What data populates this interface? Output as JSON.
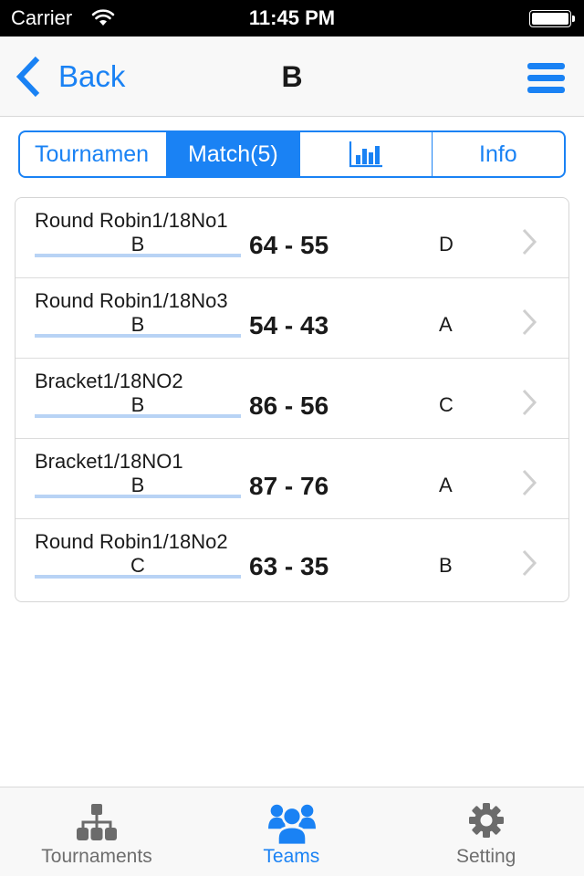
{
  "status_bar": {
    "carrier": "Carrier",
    "time": "11:45 PM",
    "wifi_icon": "wifi-icon",
    "battery_icon": "battery-full-icon"
  },
  "nav_bar": {
    "back_label": "Back",
    "title": "B",
    "back_icon": "chevron-left-icon",
    "menu_icon": "hamburger-menu-icon"
  },
  "segments": [
    {
      "label": "Tournamen",
      "active": false
    },
    {
      "label": "Match(5)",
      "active": true
    },
    {
      "label": "",
      "icon": "bar-chart-icon",
      "active": false
    },
    {
      "label": "Info",
      "active": false
    }
  ],
  "matches": [
    {
      "name": "Round Robin1/18No1",
      "home": "B",
      "score": "64 - 55",
      "away": "D"
    },
    {
      "name": "Round Robin1/18No3",
      "home": "B",
      "score": "54 - 43",
      "away": "A"
    },
    {
      "name": "Bracket1/18NO2",
      "home": "B",
      "score": "86 - 56",
      "away": "C"
    },
    {
      "name": "Bracket1/18NO1",
      "home": "B",
      "score": "87 - 76",
      "away": "A"
    },
    {
      "name": "Round Robin1/18No2",
      "home": "C",
      "score": "63 - 35",
      "away": "B"
    }
  ],
  "tab_bar": {
    "items": [
      {
        "label": "Tournaments",
        "icon": "sitemap-icon",
        "active": false
      },
      {
        "label": "Teams",
        "icon": "users-icon",
        "active": true
      },
      {
        "label": "Setting",
        "icon": "gear-icon",
        "active": false
      }
    ]
  },
  "colors": {
    "accent": "#1a82f4",
    "underline": "#b8d3f5",
    "inactive_tab": "#6e6e6e",
    "chevron": "#cfcfcf"
  }
}
